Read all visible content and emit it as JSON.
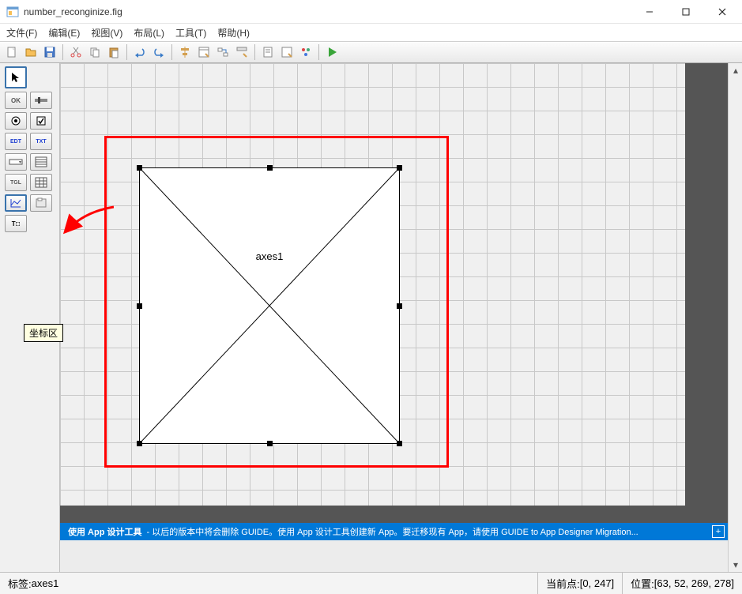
{
  "window": {
    "title": "number_reconginize.fig"
  },
  "menu": {
    "file": "文件(F)",
    "edit": "编辑(E)",
    "view": "视图(V)",
    "layout": "布局(L)",
    "tools": "工具(T)",
    "help": "帮助(H)"
  },
  "palette": {
    "select": "↖",
    "ok": "OK",
    "slider": "▬",
    "radio": "◉",
    "check": "☑",
    "edit": "EDT",
    "text": "TXT",
    "popup": "▭",
    "list": "▤",
    "toggle": "TGL",
    "table": "▦",
    "axes": "⬚",
    "panel": "▣",
    "tx": "Tx"
  },
  "tooltip": "坐标区",
  "canvas": {
    "axes_label": "axes1"
  },
  "banner": {
    "bold": "使用 App 设计工具",
    "rest": " - 以后的版本中将会删除 GUIDE。使用 App 设计工具创建新 App。要迁移现有 App，请使用 GUIDE to App Designer Migration..."
  },
  "status": {
    "tag_label": "标签: ",
    "tag_value": "axes1",
    "curpoint_label": "当前点: ",
    "curpoint_value": "[0, 247]",
    "pos_label": "位置: ",
    "pos_value": "[63, 52, 269, 278]"
  }
}
